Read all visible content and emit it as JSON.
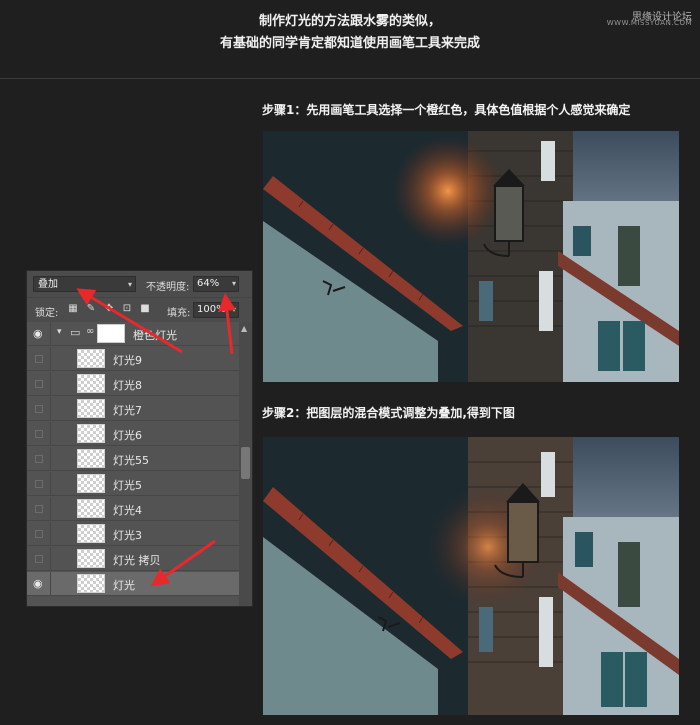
{
  "header": {
    "line1": "制作灯光的方法跟水雾的类似，",
    "line2": "有基础的同学肯定都知道使用画笔工具来完成",
    "watermark": "思缘设计论坛",
    "watermark_url": "WWW.MISSYUAN.COM"
  },
  "steps": {
    "step1": "步骤1：先用画笔工具选择一个橙红色，具体色值根据个人感觉来确定",
    "step2": "步骤2：把图层的混合模式调整为叠加,得到下图"
  },
  "panel": {
    "blend_mode": "叠加",
    "opacity_label": "不透明度:",
    "opacity_value": "64%",
    "lock_label": "锁定:",
    "fill_label": "填充:",
    "fill_value": "100%",
    "group_name": "橙色灯光",
    "layers": [
      {
        "name": "灯光9",
        "visible": false
      },
      {
        "name": "灯光8",
        "visible": false
      },
      {
        "name": "灯光7",
        "visible": false
      },
      {
        "name": "灯光6",
        "visible": false
      },
      {
        "name": "灯光55",
        "visible": false
      },
      {
        "name": "灯光5",
        "visible": false
      },
      {
        "name": "灯光4",
        "visible": false
      },
      {
        "name": "灯光3",
        "visible": false
      },
      {
        "name": "灯光 拷贝",
        "visible": false
      },
      {
        "name": "灯光",
        "visible": true,
        "selected": true
      }
    ]
  },
  "colors": {
    "background": "#1f1f1f",
    "panel": "#535353",
    "arrow": "#e8282b",
    "glow": "#ff8a3a"
  },
  "icons": [
    "eye-icon",
    "folder-icon",
    "link-icon",
    "lock-transparent-icon",
    "lock-paint-icon",
    "lock-move-icon",
    "lock-artboard-icon",
    "lock-all-icon",
    "chevron-down-icon"
  ]
}
